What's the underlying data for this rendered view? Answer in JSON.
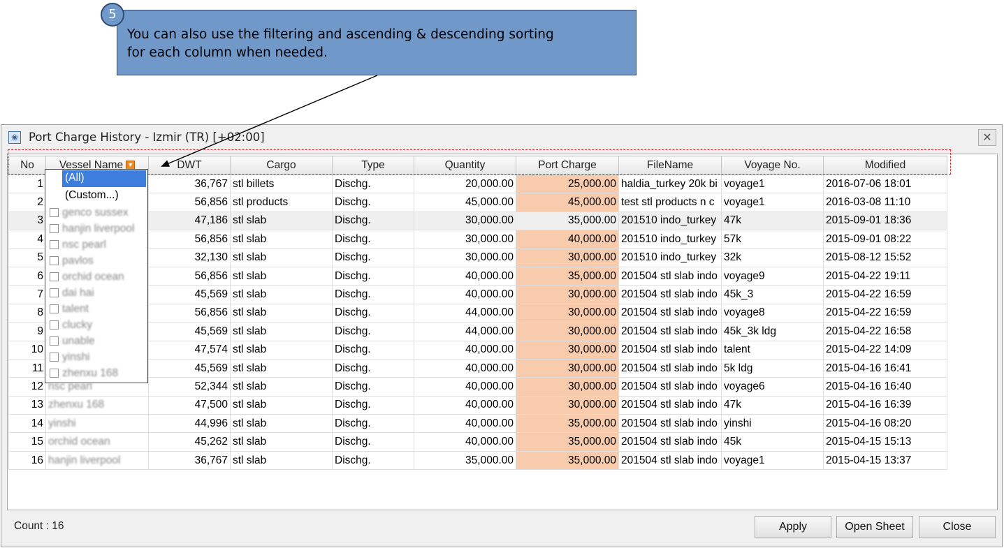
{
  "callout": {
    "step": "5",
    "line1": "You can also use the filtering and ascending & descending sorting",
    "line2": "for each column when needed."
  },
  "window": {
    "title": "Port Charge History - Izmir (TR) [+02:00]",
    "close_glyph": "✕",
    "icon": "settings-app-icon"
  },
  "grid": {
    "columns": [
      "No",
      "Vessel Name",
      "DWT",
      "Cargo",
      "Type",
      "Quantity",
      "Port Charge",
      "FileName",
      "Voyage No.",
      "Modified"
    ],
    "rows": [
      {
        "no": "1",
        "vessel": "",
        "dwt": "36,767",
        "cargo": "stl billets",
        "type": "Dischg.",
        "qty": "20,000.00",
        "pc": "25,000.00",
        "file": "haldia_turkey 20k bi",
        "voyage": "voyage1",
        "modified": "2016-07-06 18:01"
      },
      {
        "no": "2",
        "vessel": "",
        "dwt": "56,856",
        "cargo": "stl products",
        "type": "Dischg.",
        "qty": "45,000.00",
        "pc": "45,000.00",
        "file": "test stl products n c",
        "voyage": "voyage1",
        "modified": "2016-03-08 11:10"
      },
      {
        "no": "3",
        "vessel": "",
        "dwt": "47,186",
        "cargo": "stl slab",
        "type": "Dischg.",
        "qty": "30,000.00",
        "pc": "35,000.00",
        "file": "201510 indo_turkey",
        "voyage": "47k",
        "modified": "2015-09-01 18:36"
      },
      {
        "no": "4",
        "vessel": "",
        "dwt": "56,856",
        "cargo": "stl slab",
        "type": "Dischg.",
        "qty": "30,000.00",
        "pc": "40,000.00",
        "file": "201510 indo_turkey",
        "voyage": "57k",
        "modified": "2015-09-01 08:22"
      },
      {
        "no": "5",
        "vessel": "",
        "dwt": "32,130",
        "cargo": "stl slab",
        "type": "Dischg.",
        "qty": "30,000.00",
        "pc": "30,000.00",
        "file": "201510 indo_turkey",
        "voyage": "32k",
        "modified": "2015-08-12 15:52"
      },
      {
        "no": "6",
        "vessel": "",
        "dwt": "56,856",
        "cargo": "stl slab",
        "type": "Dischg.",
        "qty": "40,000.00",
        "pc": "35,000.00",
        "file": "201504 stl slab indo",
        "voyage": "voyage9",
        "modified": "2015-04-22 19:11"
      },
      {
        "no": "7",
        "vessel": "",
        "dwt": "45,569",
        "cargo": "stl slab",
        "type": "Dischg.",
        "qty": "40,000.00",
        "pc": "30,000.00",
        "file": "201504 stl slab indo",
        "voyage": "45k_3",
        "modified": "2015-04-22 16:59"
      },
      {
        "no": "8",
        "vessel": "",
        "dwt": "56,856",
        "cargo": "stl slab",
        "type": "Dischg.",
        "qty": "44,000.00",
        "pc": "30,000.00",
        "file": "201504 stl slab indo",
        "voyage": "voyage8",
        "modified": "2015-04-22 16:59"
      },
      {
        "no": "9",
        "vessel": "",
        "dwt": "45,569",
        "cargo": "stl slab",
        "type": "Dischg.",
        "qty": "44,000.00",
        "pc": "30,000.00",
        "file": "201504 stl slab indo",
        "voyage": "45k_3k ldg",
        "modified": "2015-04-22 16:58"
      },
      {
        "no": "10",
        "vessel": "",
        "dwt": "47,574",
        "cargo": "stl slab",
        "type": "Dischg.",
        "qty": "40,000.00",
        "pc": "30,000.00",
        "file": "201504 stl slab indo",
        "voyage": "talent",
        "modified": "2015-04-22 14:09"
      },
      {
        "no": "11",
        "vessel": "",
        "dwt": "45,569",
        "cargo": "stl slab",
        "type": "Dischg.",
        "qty": "40,000.00",
        "pc": "30,000.00",
        "file": "201504 stl slab indo",
        "voyage": "5k ldg",
        "modified": "2015-04-16 16:41"
      },
      {
        "no": "12",
        "vessel": "nsc pearl",
        "dwt": "52,344",
        "cargo": "stl slab",
        "type": "Dischg.",
        "qty": "40,000.00",
        "pc": "30,000.00",
        "file": "201504 stl slab indo",
        "voyage": "voyage6",
        "modified": "2015-04-16 16:40"
      },
      {
        "no": "13",
        "vessel": "zhenxu 168",
        "dwt": "47,500",
        "cargo": "stl slab",
        "type": "Dischg.",
        "qty": "40,000.00",
        "pc": "30,000.00",
        "file": "201504 stl slab indo",
        "voyage": "47k",
        "modified": "2015-04-16 16:39"
      },
      {
        "no": "14",
        "vessel": "yinshi",
        "dwt": "44,996",
        "cargo": "stl slab",
        "type": "Dischg.",
        "qty": "40,000.00",
        "pc": "35,000.00",
        "file": "201504 stl slab indo",
        "voyage": "yinshi",
        "modified": "2015-04-16 08:20"
      },
      {
        "no": "15",
        "vessel": "orchid ocean",
        "dwt": "45,262",
        "cargo": "stl slab",
        "type": "Dischg.",
        "qty": "40,000.00",
        "pc": "35,000.00",
        "file": "201504 stl slab indo",
        "voyage": "45k",
        "modified": "2015-04-15 15:13"
      },
      {
        "no": "16",
        "vessel": "hanjin liverpool",
        "dwt": "36,767",
        "cargo": "stl slab",
        "type": "Dischg.",
        "qty": "35,000.00",
        "pc": "35,000.00",
        "file": "201504 stl slab indo",
        "voyage": "voyage1",
        "modified": "2015-04-15 13:37"
      }
    ]
  },
  "filter_dropdown": {
    "all_label": "(All)",
    "custom_label": "(Custom...)",
    "options": [
      "genco sussex",
      "hanjin liverpool",
      "nsc pearl",
      "pavlos",
      "orchid ocean",
      "dai hai",
      "talent",
      "clucky",
      "unable",
      "yinshi",
      "zhenxu 168"
    ]
  },
  "footer": {
    "count_label": "Count : 16",
    "apply_label": "Apply",
    "open_sheet_label": "Open Sheet",
    "close_label": "Close"
  },
  "colors": {
    "callout_bg": "#7099c9",
    "port_charge_highlight": "#f8cbad",
    "selection": "#3d7ddb",
    "highlight_dash": "#e0202a"
  }
}
